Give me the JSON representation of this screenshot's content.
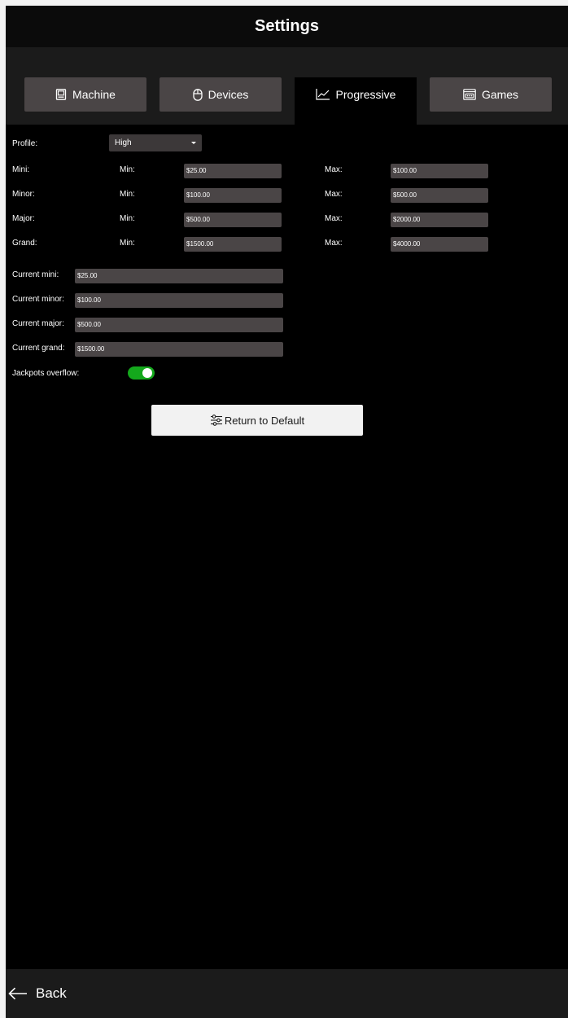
{
  "window": {
    "title": "Settings"
  },
  "tabs": [
    {
      "label": "Machine",
      "icon": "machine-icon",
      "active": false
    },
    {
      "label": "Devices",
      "icon": "mouse-icon",
      "active": false
    },
    {
      "label": "Progressive",
      "icon": "chart-line-icon",
      "active": true
    },
    {
      "label": "Games",
      "icon": "games-icon",
      "active": false
    }
  ],
  "profile": {
    "label": "Profile:",
    "value": "High"
  },
  "levels": [
    {
      "label": "Mini:",
      "min_label": "Min:",
      "min": "$25.00",
      "max_label": "Max:",
      "max": "$100.00"
    },
    {
      "label": "Minor:",
      "min_label": "Min:",
      "min": "$100.00",
      "max_label": "Max:",
      "max": "$500.00"
    },
    {
      "label": "Major:",
      "min_label": "Min:",
      "min": "$500.00",
      "max_label": "Max:",
      "max": "$2000.00"
    },
    {
      "label": "Grand:",
      "min_label": "Min:",
      "min": "$1500.00",
      "max_label": "Max:",
      "max": "$4000.00"
    }
  ],
  "current": [
    {
      "label": "Current mini:",
      "value": "$25.00"
    },
    {
      "label": "Current minor:",
      "value": "$100.00"
    },
    {
      "label": "Current major:",
      "value": "$500.00"
    },
    {
      "label": "Current grand:",
      "value": "$1500.00"
    }
  ],
  "overflow": {
    "label": "Jackpots overflow:",
    "on": true
  },
  "actions": {
    "return_default": "Return to Default"
  },
  "footer": {
    "back_label": "Back"
  },
  "colors": {
    "background": "#000000",
    "panel": "#1b1b1b",
    "tab": "#4a4546",
    "field": "#4a4546",
    "toggle_on": "#14a81c",
    "button": "#f2f2f2"
  }
}
